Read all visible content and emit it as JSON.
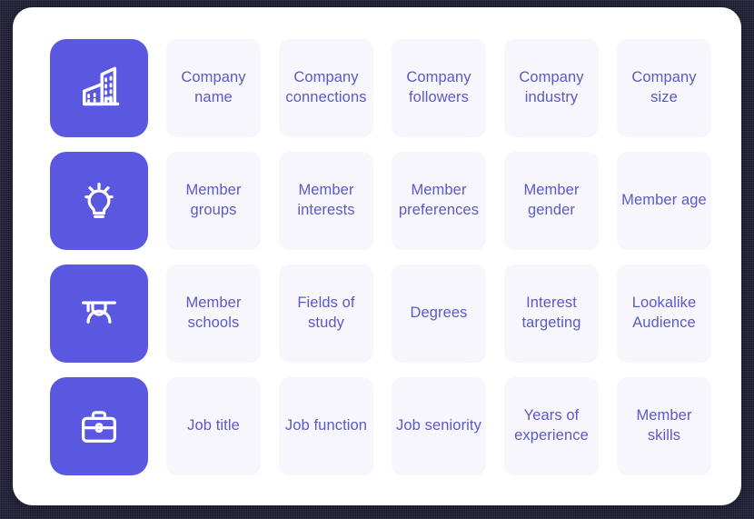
{
  "theme": {
    "page_background": "#12122a",
    "card_background": "#ffffff",
    "icon_tile_color": "#5A57E0",
    "label_tile_color": "#f6f6fc",
    "label_text_color": "#5c59c9"
  },
  "grid": {
    "rows": [
      {
        "icon": "company-building-icon",
        "icon_label": "Company",
        "tiles": [
          "Company name",
          "Company connections",
          "Company followers",
          "Company industry",
          "Company size"
        ]
      },
      {
        "icon": "lightbulb-icon",
        "icon_label": "Interests",
        "tiles": [
          "Member groups",
          "Member interests",
          "Member preferences",
          "Member gender",
          "Member age"
        ]
      },
      {
        "icon": "graduate-cap-icon",
        "icon_label": "Education",
        "tiles": [
          "Member schools",
          "Fields of study",
          "Degrees",
          "Interest targeting",
          "Lookalike Audience"
        ]
      },
      {
        "icon": "briefcase-icon",
        "icon_label": "Job",
        "tiles": [
          "Job title",
          "Job function",
          "Job seniority",
          "Years of experience",
          "Member skills"
        ]
      }
    ]
  }
}
